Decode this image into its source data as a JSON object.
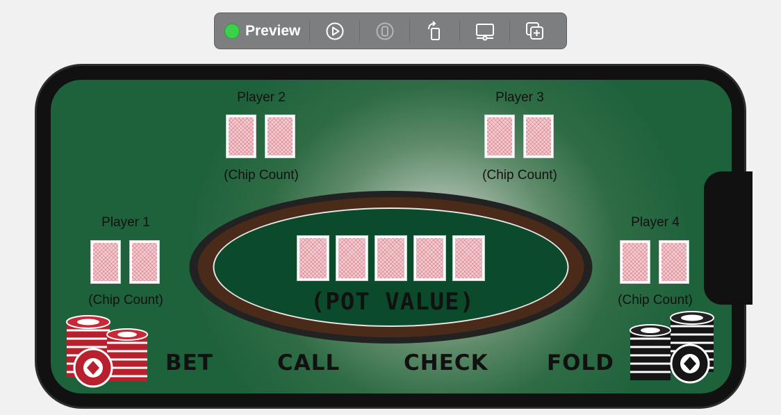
{
  "toolbar": {
    "preview_label": "Preview",
    "status_color": "#3ad24a",
    "buttons": [
      "live-preview-icon",
      "device-icon",
      "rotate-icon",
      "device-settings-icon",
      "duplicate-icon"
    ]
  },
  "players": [
    {
      "name": "Player 1",
      "chip_label": "(Chip Count)"
    },
    {
      "name": "Player 2",
      "chip_label": "(Chip Count)"
    },
    {
      "name": "Player 3",
      "chip_label": "(Chip Count)"
    },
    {
      "name": "Player 4",
      "chip_label": "(Chip Count)"
    }
  ],
  "table": {
    "pot_label": "(POT VALUE)",
    "felt_color": "#1e623c",
    "rail_color": "#4a2b1a"
  },
  "actions": {
    "bet": "BET",
    "call": "CALL",
    "check": "CHECK",
    "fold": "FOLD"
  }
}
